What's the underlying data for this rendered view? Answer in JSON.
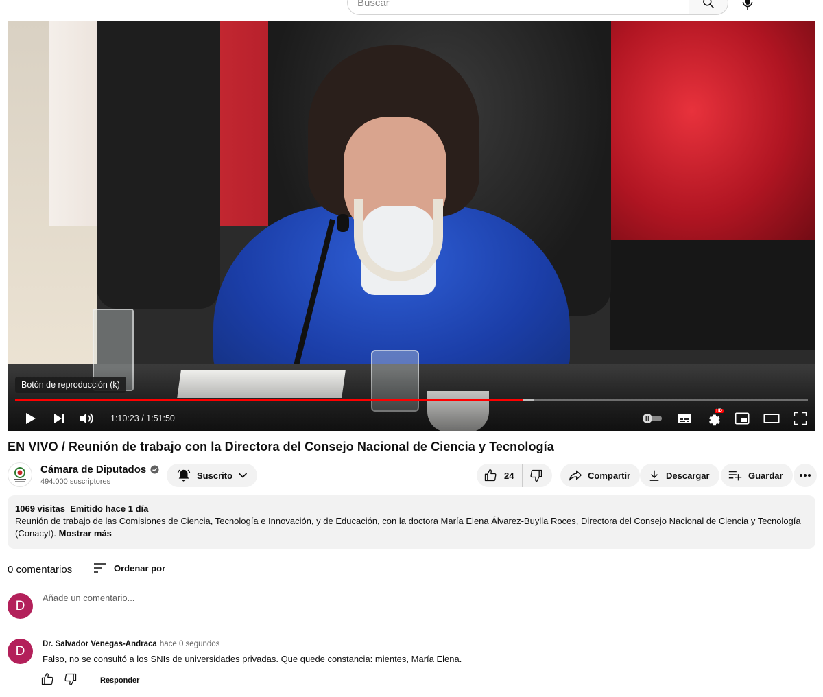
{
  "search": {
    "placeholder": "Buscar",
    "search_icon": "search-icon",
    "mic_icon": "mic-icon"
  },
  "player": {
    "tooltip": "Botón de reproducción (k)",
    "time_current": "1:10:23",
    "time_separator": " / ",
    "time_total": "1:51:50",
    "progress_played": 0.641,
    "progress_buffered": 0.654,
    "progress_color": "#ff0000"
  },
  "video": {
    "title": "EN VIVO / Reunión de trabajo con la Directora del Consejo Nacional de Ciencia y Tecnología"
  },
  "channel": {
    "name": "Cámara de Diputados",
    "subscribers": "494.000 suscriptores",
    "subscribe_label": "Suscrito",
    "verified_icon": "verified-icon"
  },
  "actions": {
    "likes": "24",
    "share_label": "Compartir",
    "download_label": "Descargar",
    "save_label": "Guardar"
  },
  "description": {
    "meta": "1069 visitas  Emitido hace 1 día",
    "text": "Reunión de trabajo de las Comisiones de Ciencia, Tecnología e Innovación, y de Educación, con la doctora María Elena Álvarez-Buylla Roces, Directora del Consejo Nacional de Ciencia y Tecnología (Conacyt).",
    "more_label": "Mostrar más"
  },
  "comments": {
    "count_label": "0 comentarios",
    "sort_label": "Ordenar por",
    "add_placeholder": "Añade un comentario...",
    "user_initial": "D",
    "avatar_color": "#b3205a",
    "items": [
      {
        "initial": "D",
        "author": "Dr. Salvador Venegas-Andraca",
        "time": "hace 0 segundos",
        "text": "Falso, no se consultó a los SNIs de universidades privadas. Que quede constancia: mientes, María Elena.",
        "reply_label": "Responder"
      }
    ]
  }
}
